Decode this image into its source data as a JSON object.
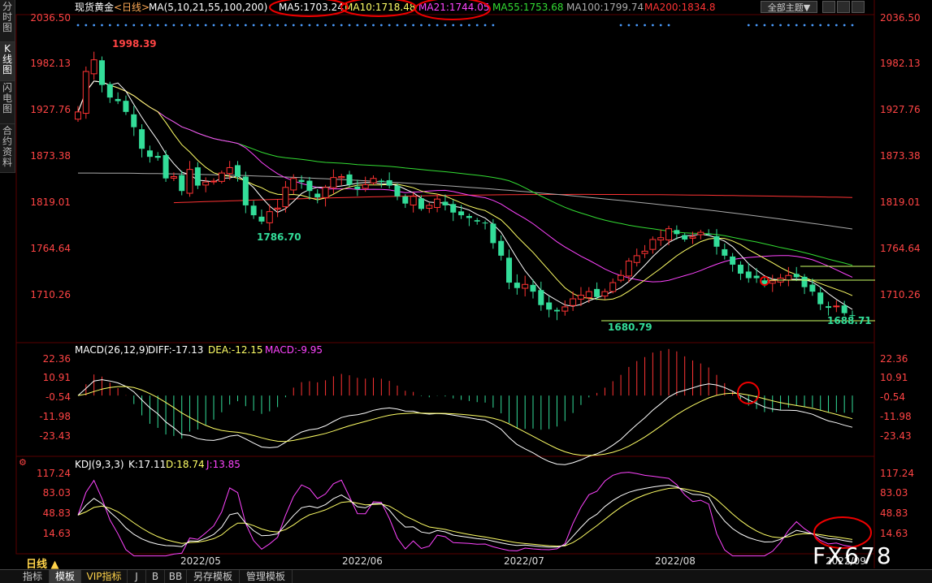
{
  "side_tabs": [
    {
      "label": "分时图",
      "chars": [
        "分",
        "时",
        "图"
      ],
      "active": false
    },
    {
      "label": "K线图",
      "chars": [
        "K",
        "线",
        "图"
      ],
      "active": true
    },
    {
      "label": "闪电图",
      "chars": [
        "闪",
        "电",
        "图"
      ],
      "active": false
    },
    {
      "label": "合约资料",
      "chars": [
        "合",
        "约",
        "资",
        "料"
      ],
      "active": false
    }
  ],
  "header": {
    "instrument": "现货黄金",
    "period": "<日线>",
    "ma_params": "MA(5,10,21,55,100,200)",
    "ma5": "MA5:1703.24",
    "ma10": "MA10:1718.48",
    "ma21": "MA21:1744.05",
    "ma55": "MA55:1753.68",
    "ma100": "MA100:1799.74",
    "ma200": "MA200:1834.8",
    "theme_button": "全部主题▼"
  },
  "price_panel": {
    "ticks": [
      "2036.50",
      "1982.13",
      "1927.76",
      "1873.38",
      "1819.01",
      "1764.64",
      "1710.26"
    ],
    "annotations": {
      "high": "1998.39",
      "low1": "1786.70",
      "low2": "1680.79",
      "low3": "1688.71"
    }
  },
  "macd": {
    "label": "MACD(26,12,9)",
    "diff": "DIFF:-17.13",
    "dea": "DEA:-12.15",
    "macd": "MACD:-9.95",
    "ticks": [
      "22.36",
      "10.91",
      "-0.54",
      "-11.98",
      "-23.43"
    ]
  },
  "kdj": {
    "label": "KDJ(9,3,3)",
    "k": "K:17.11",
    "d": "D:18.74",
    "j": "J:13.85",
    "ticks": [
      "117.24",
      "83.03",
      "48.83",
      "14.63"
    ]
  },
  "dates": [
    "2022/05",
    "2022/06",
    "2022/07",
    "2022/08",
    "2022/09"
  ],
  "period_label": "日线 ▲",
  "bottom_tabs": [
    "指标",
    "模板",
    "VIP指标",
    "J",
    "B",
    "BB",
    "另存模板",
    "管理模板"
  ],
  "watermark": "FX678",
  "colors": {
    "up": "#ff3333",
    "down": "#33dd99",
    "ma5": "#ffffff",
    "ma10": "#ffff66",
    "ma21": "#ff44ff",
    "ma55": "#33dd33",
    "ma100": "#aaaaaa",
    "ma200": "#ff3333"
  },
  "chart_data": {
    "type": "candlestick",
    "instrument": "现货黄金",
    "ylim": [
      1675,
      2036.5
    ],
    "price_series": {
      "close": [
        1930,
        1975,
        1988,
        1960,
        1946,
        1942,
        1930,
        1913,
        1889,
        1880,
        1879,
        1856,
        1858,
        1842,
        1866,
        1848,
        1852,
        1853,
        1862,
        1868,
        1858,
        1826,
        1815,
        1808,
        1819,
        1823,
        1846,
        1856,
        1852,
        1842,
        1835,
        1846,
        1857,
        1858,
        1849,
        1844,
        1849,
        1856,
        1852,
        1848,
        1836,
        1828,
        1836,
        1822,
        1826,
        1833,
        1826,
        1818,
        1815,
        1812,
        1808,
        1806,
        1784,
        1770,
        1740,
        1734,
        1738,
        1730,
        1715,
        1710,
        1708,
        1713,
        1722,
        1726,
        1730,
        1724,
        1730,
        1740,
        1748,
        1764,
        1770,
        1775,
        1788,
        1790,
        1800,
        1794,
        1788,
        1791,
        1796,
        1794,
        1780,
        1770,
        1760,
        1750,
        1745,
        1745,
        1738,
        1742,
        1745,
        1748,
        1746,
        1735,
        1730,
        1716,
        1712,
        1714,
        1706,
        1703
      ]
    },
    "moving_averages": {
      "MA5": 1703.24,
      "MA10": 1718.48,
      "MA21": 1744.05,
      "MA55": 1753.68,
      "MA100": 1799.74,
      "MA200": 1834.8
    },
    "macd": {
      "diff": -17.13,
      "dea": -12.15,
      "macd": -9.95,
      "ylim": [
        -30,
        26
      ]
    },
    "kdj": {
      "k": 17.11,
      "d": 18.74,
      "j": 13.85,
      "ylim": [
        0,
        125
      ]
    },
    "x_ticks": [
      "2022/05",
      "2022/06",
      "2022/07",
      "2022/08",
      "2022/09"
    ]
  }
}
